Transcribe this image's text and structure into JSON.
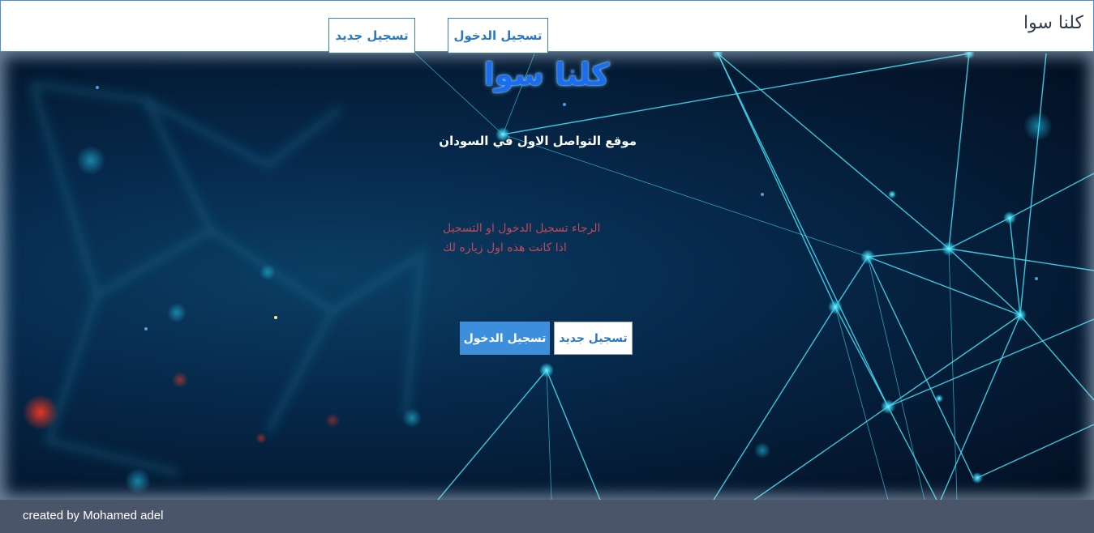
{
  "navbar": {
    "brand": "كلنا سوا",
    "login_label": "تسجيل الدخول",
    "register_label": "تسجيل جديد"
  },
  "hero": {
    "title": "كلنا سوا",
    "subtitle": "موقع التواصل الاول في السودان",
    "notice_line1": "الرجاء تسجيل الدخول او التسجيل",
    "notice_line2": "اذا كانت هذه اول زياره لك",
    "login_label": "تسجيل الدخول",
    "register_label": "تسجيل جديد"
  },
  "footer": {
    "credit": "created by Mohamed adel"
  },
  "colors": {
    "accent": "#3d8fdc",
    "link": "#2a78c2",
    "notice": "#c0485a",
    "footer_bg": "#4a5569",
    "hero_bg": "#06284a",
    "network_line": "#3fd8f0"
  }
}
